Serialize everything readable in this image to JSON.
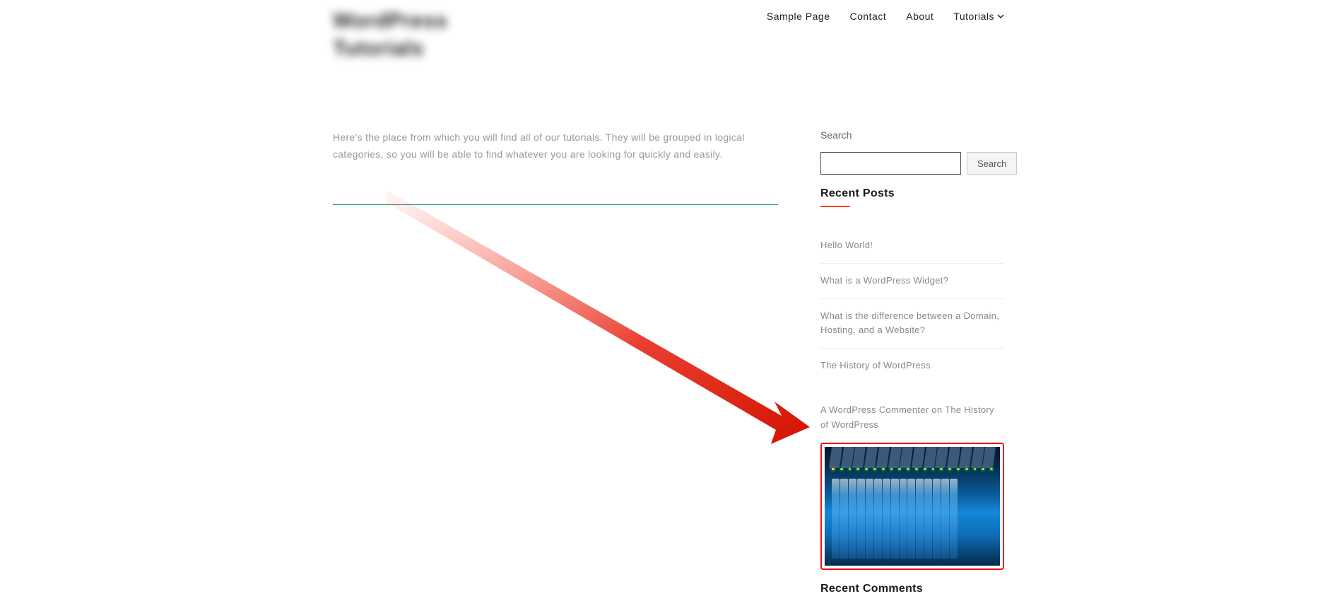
{
  "page_title": "WordPress Tutorials",
  "nav": {
    "items": [
      {
        "label": "Sample Page"
      },
      {
        "label": "Contact"
      },
      {
        "label": "About"
      },
      {
        "label": "Tutorials",
        "has_dropdown": true
      }
    ]
  },
  "main": {
    "intro": "Here's the place from which you will find all of our tutorials. They will be grouped in logical categories, so you will be able to find whatever you are looking for quickly and easily."
  },
  "sidebar": {
    "search_label": "Search",
    "search_button": "Search",
    "recent_posts_title": "Recent Posts",
    "recent_posts": [
      "Hello World!",
      "What is a WordPress Widget?",
      "What is the difference between a Domain, Hosting, and a Website?",
      "The History of WordPress"
    ],
    "recent_comment": "A WordPress Commenter on The History of WordPress",
    "recent_comments_title": "Recent Comments"
  },
  "colors": {
    "accent_orange": "#fd3d1a",
    "divider_teal": "#188a7b",
    "highlight_red": "#e11"
  }
}
